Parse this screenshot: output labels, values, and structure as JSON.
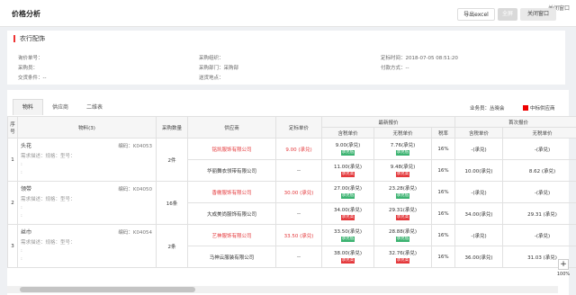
{
  "header": {
    "title": "价格分析",
    "export_label": "导出excel",
    "sign_label": "全屏",
    "close_label": "关闭窗口",
    "close_top_label": "关闭窗口"
  },
  "info": {
    "title": "农行配饰",
    "fields": [
      {
        "label": "询价单号：",
        "value": ""
      },
      {
        "label": "采购组织：",
        "value": ""
      },
      {
        "label": "定标时间：",
        "value": "2018-07-05 08:51:20"
      },
      {
        "label": "采购员：",
        "value": ""
      },
      {
        "label": "采购部门：",
        "value": "采购部"
      },
      {
        "label": "付款方式：",
        "value": "--"
      },
      {
        "label": "交货条件：",
        "value": "--"
      },
      {
        "label": "送货地点：",
        "value": ""
      }
    ]
  },
  "tabs": [
    "物料",
    "供应商",
    "二维表"
  ],
  "buyer": "业务员：丛晓会",
  "legend": "中标供应商",
  "table": {
    "headers": {
      "seq": "序号",
      "material": "物料(3)",
      "qty": "采购数量",
      "supplier": "供应商",
      "bid_price": "定标单价",
      "latest": "最新报价",
      "first": "首次报价",
      "tax_incl": "含税单价",
      "tax_excl": "无税单价",
      "tax_rate": "税率"
    },
    "rows": [
      {
        "seq": "1",
        "name": "头花",
        "code": "编码：K04053",
        "req": "需求描述：规格：型号：",
        "qty": "2件",
        "suppliers": [
          {
            "name": "铭凯服饰有限公司",
            "red": true,
            "bid": "9.00 (承兑)",
            "ti": "9.00(承兑)",
            "ti_tag": "承兑低",
            "te": "7.76(承兑)",
            "te_tag": "承兑低",
            "rate": "16%",
            "fti": "-(承兑)",
            "fte": "-(承兑)"
          },
          {
            "name": "华丽舞衣领带有限公司",
            "red": false,
            "bid": "--",
            "ti": "11.00(承兑)",
            "ti_tag": "承兑高",
            "te": "9.48(承兑)",
            "te_tag": "承兑高",
            "rate": "16%",
            "fti": "10.00(承兑)",
            "fte": "8.62 (承兑)"
          }
        ]
      },
      {
        "seq": "2",
        "name": "领带",
        "code": "编码：K04050",
        "req": "需求描述：规格：型号：",
        "qty": "16条",
        "suppliers": [
          {
            "name": "香榭服饰有限公司",
            "red": true,
            "bid": "30.00 (承兑)",
            "ti": "27.00(承兑)",
            "ti_tag": "承兑低",
            "te": "23.28(承兑)",
            "te_tag": "承兑低",
            "rate": "16%",
            "fti": "-(承兑)",
            "fte": "-(承兑)"
          },
          {
            "name": "大成美尚服饰有限公司",
            "red": false,
            "bid": "--",
            "ti": "34.00(承兑)",
            "ti_tag": "承兑高",
            "te": "29.31(承兑)",
            "te_tag": "承兑高",
            "rate": "16%",
            "fti": "34.00(承兑)",
            "fte": "29.31 (承兑)"
          }
        ]
      },
      {
        "seq": "3",
        "name": "丝巾",
        "code": "编码：K04054",
        "req": "需求描述：规格：型号：",
        "qty": "2条",
        "suppliers": [
          {
            "name": "艺神服饰有限公司",
            "red": true,
            "bid": "33.50 (承兑)",
            "ti": "33.50(承兑)",
            "ti_tag": "承兑低",
            "te": "28.88(承兑)",
            "te_tag": "承兑低",
            "rate": "16%",
            "fti": "-(承兑)",
            "fte": "-(承兑)"
          },
          {
            "name": "马神云服装有限公司",
            "red": false,
            "bid": "--",
            "ti": "38.00(承兑)",
            "ti_tag": "承兑高",
            "te": "32.76(承兑)",
            "te_tag": "承兑高",
            "rate": "16%",
            "fti": "36.00(承兑)",
            "fte": "31.03 (承兑)"
          }
        ]
      }
    ]
  },
  "zoom": {
    "level": "100%"
  }
}
